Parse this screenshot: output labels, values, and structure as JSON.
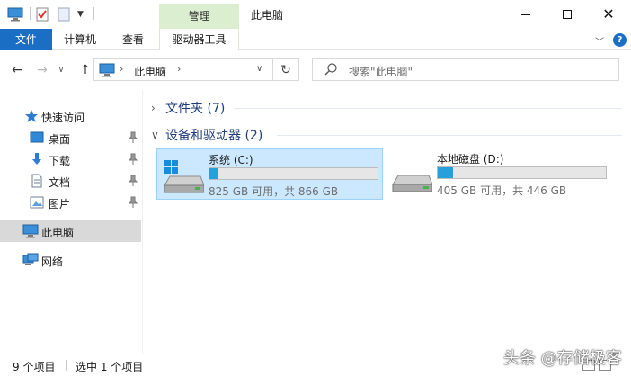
{
  "titlebar": {
    "context_tab": "管理",
    "title": "此电脑"
  },
  "ribbon": {
    "tabs": [
      "文件",
      "计算机",
      "查看",
      "驱动器工具"
    ],
    "help_label": "?"
  },
  "address": {
    "crumb": "此电脑",
    "search_placeholder": "搜索\"此电脑\""
  },
  "sidebar": {
    "items": [
      {
        "label": "快速访问",
        "icon": "star-icon"
      },
      {
        "label": "桌面",
        "icon": "desktop-icon",
        "pinned": true
      },
      {
        "label": "下载",
        "icon": "download-icon",
        "pinned": true
      },
      {
        "label": "文档",
        "icon": "document-icon",
        "pinned": true
      },
      {
        "label": "图片",
        "icon": "picture-icon",
        "pinned": true
      },
      {
        "label": "此电脑",
        "icon": "computer-icon",
        "selected": true
      },
      {
        "label": "网络",
        "icon": "network-icon"
      }
    ]
  },
  "content": {
    "groups": [
      {
        "label": "文件夹 (7)"
      },
      {
        "label": "设备和驱动器 (2)"
      }
    ],
    "drives": [
      {
        "name": "系统 (C:)",
        "free_text": "825 GB 可用，共 866 GB",
        "used_fraction": 0.05,
        "selected": true,
        "icon": "windows-drive-icon"
      },
      {
        "name": "本地磁盘 (D:)",
        "free_text": "405 GB 可用，共 446 GB",
        "used_fraction": 0.09,
        "selected": false,
        "icon": "hard-drive-icon"
      }
    ]
  },
  "statusbar": {
    "count": "9 个项目",
    "selection": "选中 1 个项目"
  },
  "watermark": "头条 @存储极客",
  "colors": {
    "accent": "#1a6fc4",
    "context_tab": "#dbeed0",
    "selection": "#cce8ff",
    "drive_bar": "#26a0da"
  }
}
